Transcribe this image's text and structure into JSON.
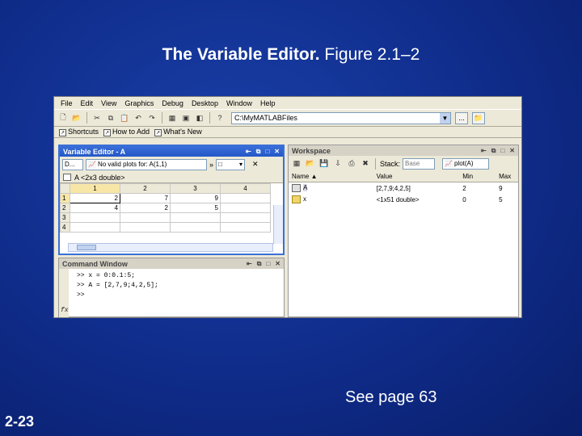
{
  "slide": {
    "title_bold": "The Variable Editor.",
    "title_rest": "Figure 2.1–2",
    "see_page": "See page 63",
    "slide_number": "2-23"
  },
  "matlab": {
    "menu": [
      "File",
      "Edit",
      "View",
      "Graphics",
      "Debug",
      "Desktop",
      "Window",
      "Help"
    ],
    "current_dir": "C:\\MyMATLABFiles",
    "browse_label": "...",
    "shortcuts": {
      "shortcuts": "Shortcuts",
      "how_to_add": "How to Add",
      "whats_new": "What's New"
    },
    "variable_editor": {
      "title": "Variable Editor - A",
      "format": "D...",
      "plot_select": "No valid plots for: A(1,1)",
      "more": "»",
      "var_label": "A <2x3 double>",
      "columns": [
        "1",
        "2",
        "3",
        "4"
      ],
      "rows": [
        {
          "h": "1",
          "cells": [
            "2",
            "7",
            "9",
            ""
          ]
        },
        {
          "h": "2",
          "cells": [
            "4",
            "2",
            "5",
            ""
          ]
        },
        {
          "h": "3",
          "cells": [
            "",
            "",
            "",
            ""
          ]
        },
        {
          "h": "4",
          "cells": [
            "",
            "",
            "",
            ""
          ]
        }
      ]
    },
    "command_window": {
      "title": "Command Window",
      "lines": [
        ">> x = 0:0.1:5;",
        ">> A = [2,7,9;4,2,5];",
        ">>"
      ],
      "fx": "fx"
    },
    "workspace": {
      "title": "Workspace",
      "stack_label": "Stack:",
      "stack_value": "Base",
      "plot_value": "plot(A)",
      "headers": [
        "Name ▲",
        "Value",
        "Min",
        "Max"
      ],
      "rows": [
        {
          "name": "A",
          "value": "[2,7,9;4,2,5]",
          "min": "2",
          "max": "9"
        },
        {
          "name": "x",
          "value": "<1x51 double>",
          "min": "0",
          "max": "5"
        }
      ]
    }
  }
}
